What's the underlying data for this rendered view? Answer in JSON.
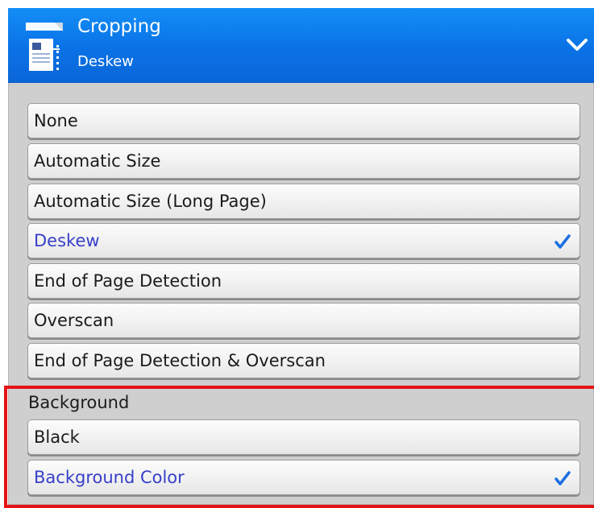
{
  "header": {
    "title": "Cropping",
    "subtitle": "Deskew",
    "icon": "document-crop-icon",
    "toggle_icon": "chevron-down-icon",
    "accent_color": "#0a72e6"
  },
  "options": [
    {
      "label": "None",
      "selected": false
    },
    {
      "label": "Automatic Size",
      "selected": false
    },
    {
      "label": "Automatic Size (Long Page)",
      "selected": false
    },
    {
      "label": "Deskew",
      "selected": true
    },
    {
      "label": "End of Page Detection",
      "selected": false
    },
    {
      "label": "Overscan",
      "selected": false
    },
    {
      "label": "End of Page Detection & Overscan",
      "selected": false
    }
  ],
  "background": {
    "section_label": "Background",
    "options": [
      {
        "label": "Black",
        "selected": false
      },
      {
        "label": "Background Color",
        "selected": true
      }
    ]
  },
  "colors": {
    "selected_text": "#3740c8",
    "check_mark": "#1a6fe0",
    "highlight_border": "#e41414"
  }
}
